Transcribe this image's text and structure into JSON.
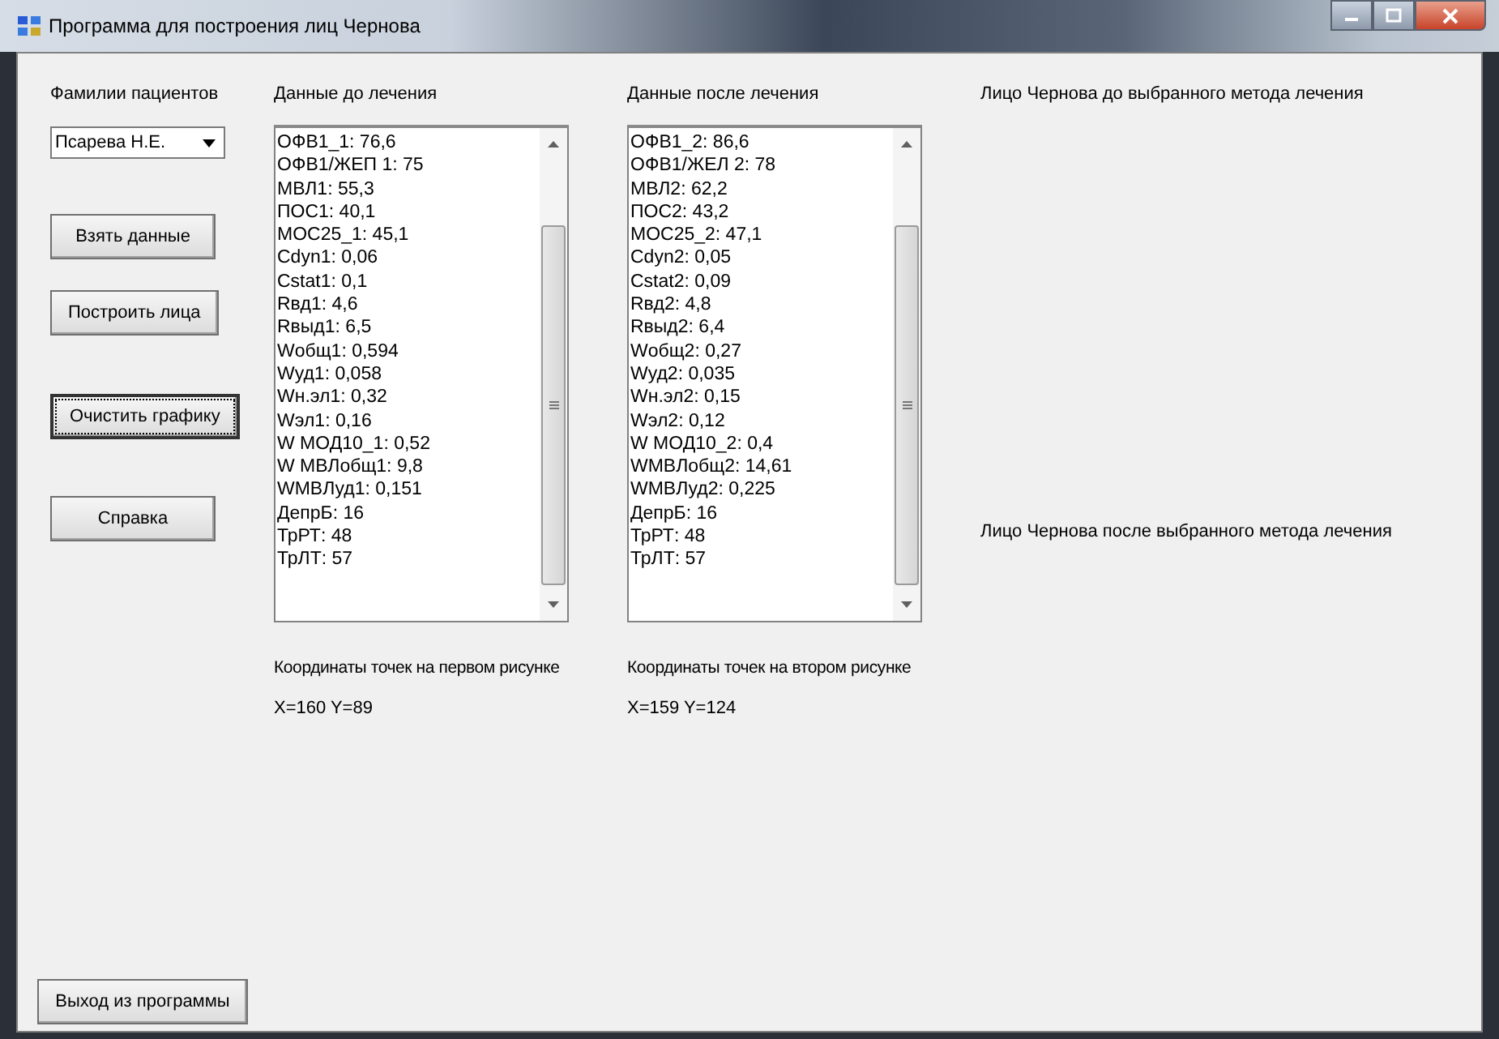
{
  "window": {
    "title": "Программа для построения лиц Чернова"
  },
  "patients": {
    "label": "Фамилии пациентов",
    "value": "Псарева Н.Е."
  },
  "buttons": [
    {
      "label": "Взять данные",
      "focused": false
    },
    {
      "label": "Построить лица",
      "focused": false
    },
    {
      "label": "Очистить графику",
      "focused": true
    },
    {
      "label": "Справка",
      "focused": false
    }
  ],
  "before": {
    "label": "Данные до лечения",
    "lines": [
      "ОФВ1_1:  76,6",
      "ОФВ1/ЖЕП 1:  75",
      "МВЛ1:  55,3",
      "ПОС1:  40,1",
      "МОС25_1:  45,1",
      "Cdyn1:  0,06",
      "Cstat1:  0,1",
      "Rвд1:  4,6",
      "Rвыд1:  6,5",
      "Wобщ1:  0,594",
      "Wуд1:  0,058",
      "Wн.эл1:  0,32",
      "Wэл1:  0,16",
      "W МОД10_1:  0,52",
      "W МВЛобщ1:  9,8",
      "WMBЛуд1:  0,151",
      "ДепрБ:  16",
      "ТрРТ:  48",
      "ТрЛТ:  57"
    ],
    "coords_label": "Координаты точек на первом рисунке",
    "coords": "X=160 Y=89"
  },
  "after": {
    "label": "Данные после лечения",
    "lines": [
      "ОФВ1_2:  86,6",
      "ОФВ1/ЖЕЛ 2:  78",
      "МВЛ2:  62,2",
      "ПОС2:  43,2",
      "МОС25_2:  47,1",
      "Cdyn2:  0,05",
      "Cstat2:  0,09",
      "Rвд2:  4,8",
      "Rвыд2:  6,4",
      "Wобщ2:  0,27",
      "Wуд2:  0,035",
      "Wн.эл2:  0,15",
      "Wэл2:  0,12",
      "W МОД10_2:  0,4",
      "WMBЛобщ2:  14,61",
      "WMBЛуд2:  0,225",
      "ДепрБ:  16",
      "ТрРТ:  48",
      "ТрЛТ:  57"
    ],
    "coords_label": "Координаты точек на втором рисунке",
    "coords": "X=159 Y=124"
  },
  "face_before_label": "Лицо Чернова до выбранного метода лечения",
  "face_after_label": "Лицо Чернова после выбранного метода лечения",
  "exit_button": "Выход из программы"
}
